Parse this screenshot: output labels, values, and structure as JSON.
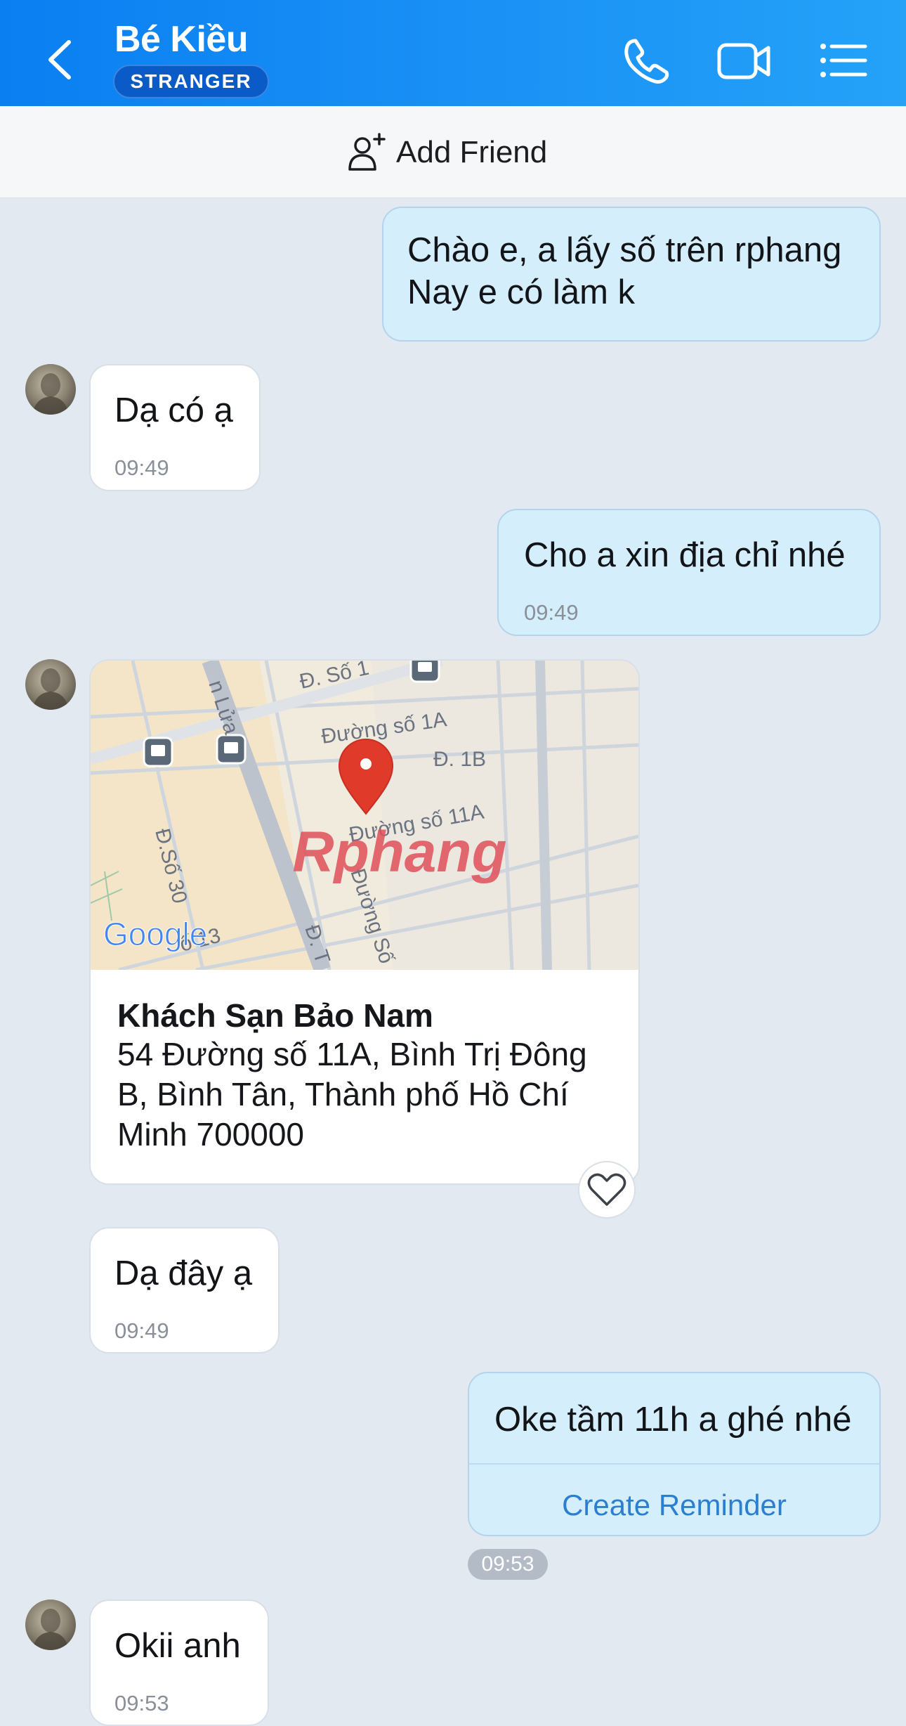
{
  "header": {
    "contact_name": "Bé Kiều",
    "badge": "STRANGER",
    "icons": [
      "back-chevron-icon",
      "phone-icon",
      "video-camera-icon",
      "list-menu-icon"
    ]
  },
  "add_friend": {
    "label": "Add Friend",
    "icon": "add-user-icon"
  },
  "messages": [
    {
      "direction": "outgoing",
      "lines": [
        "Chào e, a lấy số trên rphang",
        "Nay e có làm k"
      ]
    },
    {
      "direction": "incoming",
      "text": "Dạ có ạ",
      "time": "09:49"
    },
    {
      "direction": "outgoing",
      "text": "Cho a xin địa chỉ nhé",
      "time": "09:49"
    },
    {
      "direction": "incoming",
      "type": "location",
      "map": {
        "street_labels": [
          "Đ. Số 1",
          "Đường số 1A",
          "Đ. 1B",
          "Đường số 11A",
          "n Lửa",
          "Đ.Số 30",
          "Đường Số",
          "Đ. T",
          "ố 13"
        ],
        "watermark": "Rphang",
        "logo": "Google"
      },
      "place_name": "Khách Sạn Bảo Nam",
      "address": "54 Đường số 11A, Bình Trị Đông B, Bình Tân, Thành phố Hồ Chí Minh 700000"
    },
    {
      "direction": "incoming",
      "text": "Dạ đây ạ",
      "time": "09:49"
    },
    {
      "direction": "outgoing",
      "text": "Oke tầm 11h a ghé nhé",
      "action": "Create Reminder",
      "time": "09:53"
    },
    {
      "direction": "incoming",
      "text": "Okii anh",
      "time": "09:53"
    }
  ],
  "colors": {
    "header_start": "#0a7ff2",
    "header_end": "#24a2f8",
    "outgoing_bubble": "#d4eefc",
    "incoming_bubble": "#ffffff",
    "chat_background": "#e2e9f1",
    "link": "#2c7fd0",
    "map_pin": "#e03a2a"
  }
}
